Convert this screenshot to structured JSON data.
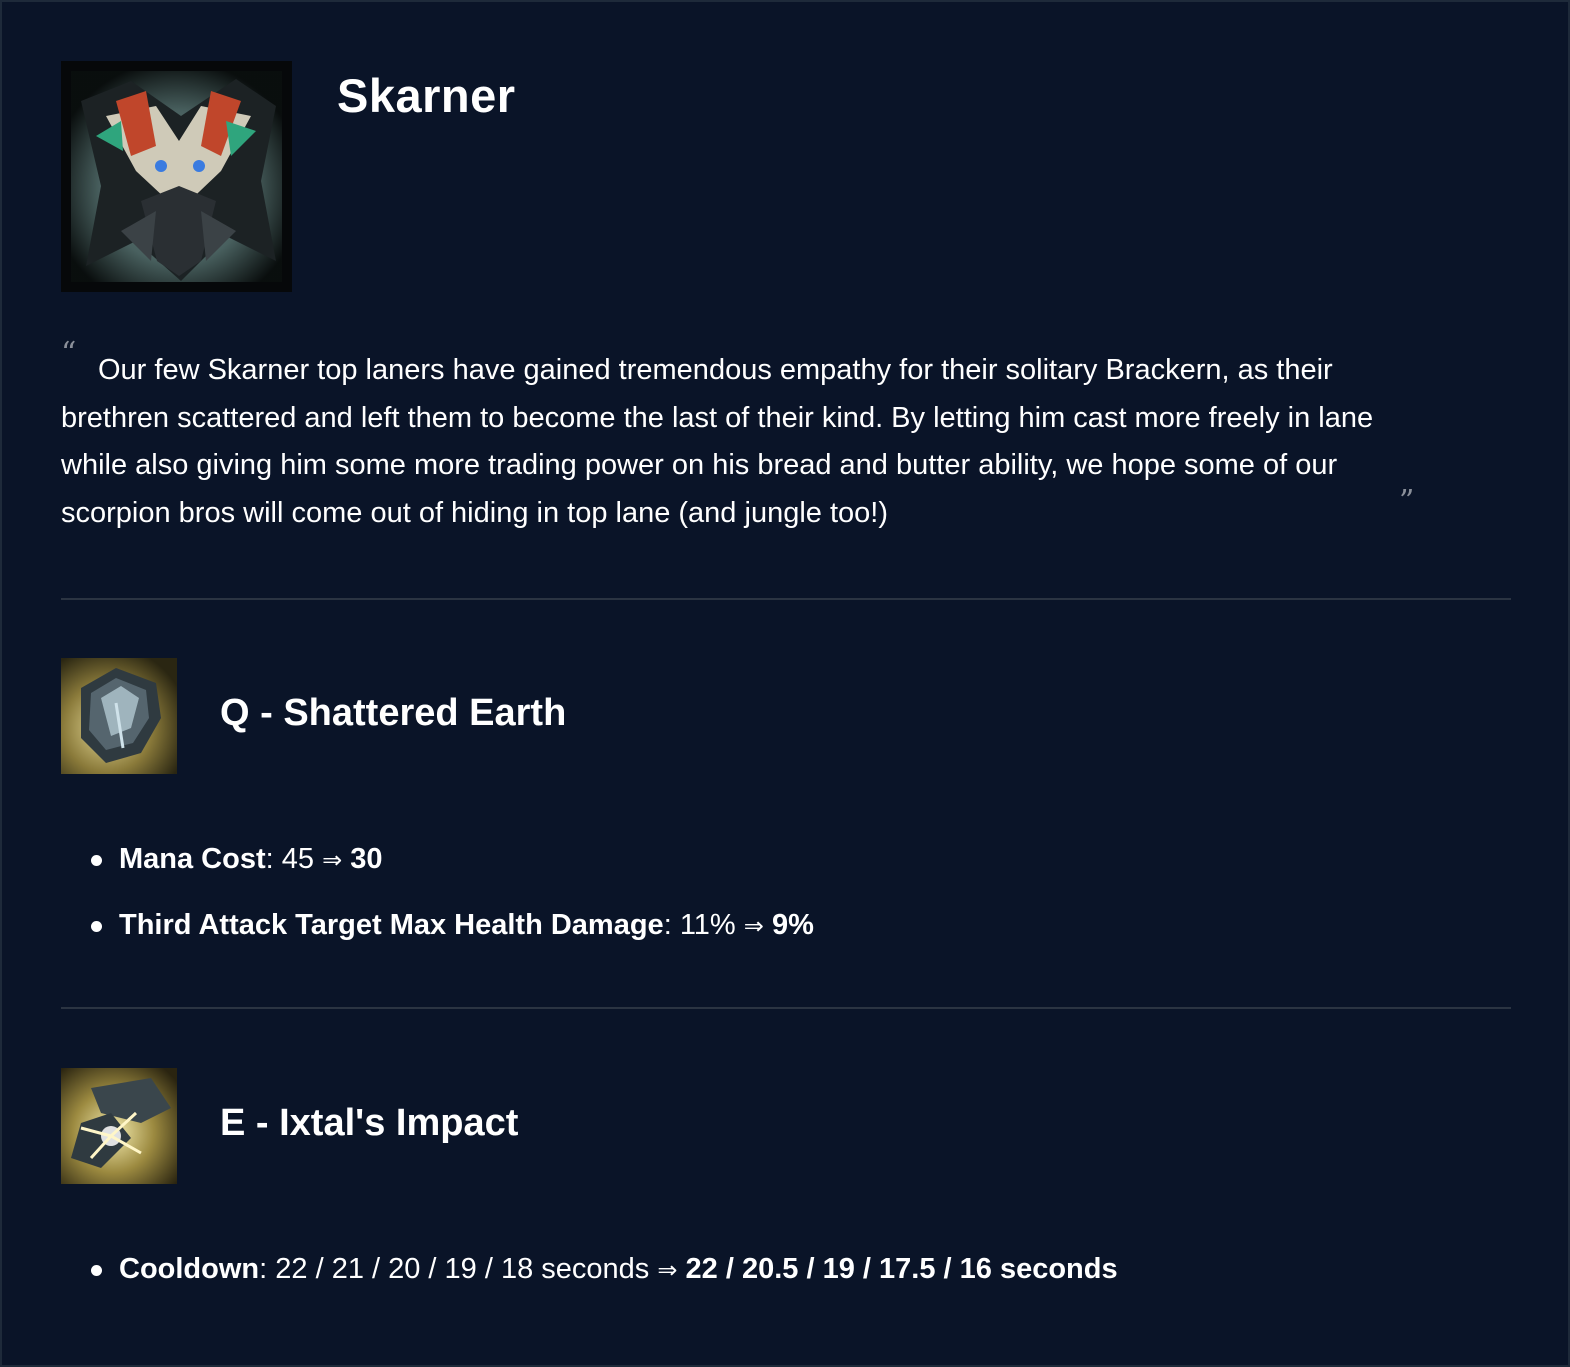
{
  "champion": {
    "name": "Skarner",
    "quote": "Our few Skarner top laners have gained tremendous empathy for their solitary Brackern, as their brethren scattered and left them to become the last of their kind. By letting him cast more freely in lane while also giving him some more trading power on his bread and butter ability, we hope some of our scorpion bros will come out of hiding in top lane (and jungle too!)",
    "quote_open": "“",
    "quote_close": "”"
  },
  "abilities": [
    {
      "title": "Q - Shattered Earth",
      "icon": "shattered-earth-icon",
      "changes": [
        {
          "attribute": "Mana Cost",
          "sep": ": ",
          "old": "45",
          "arrow": "⇒",
          "new": "30"
        },
        {
          "attribute": "Third Attack Target Max Health Damage",
          "sep": ": ",
          "old": "11%",
          "arrow": "⇒",
          "new": "9%"
        }
      ]
    },
    {
      "title": "E - Ixtal's Impact",
      "icon": "ixtals-impact-icon",
      "changes": [
        {
          "attribute": "Cooldown",
          "sep": ": ",
          "old": "22 / 21 / 20 / 19 / 18 seconds",
          "arrow": "⇒",
          "new": "22 / 20.5 / 19 / 17.5 / 16 seconds"
        }
      ]
    }
  ],
  "colors": {
    "background": "#0a1428",
    "text": "#ffffff",
    "divider": "#2b3442",
    "quote_mark": "#8a8f99"
  }
}
